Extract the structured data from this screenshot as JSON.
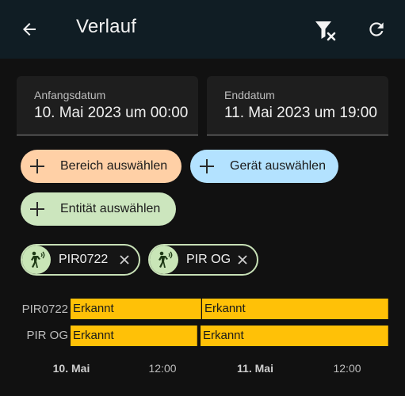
{
  "header": {
    "title": "Verlauf",
    "back_icon": "arrow-left-icon",
    "filter_icon": "filter-remove-icon",
    "refresh_icon": "refresh-icon",
    "background": "#101d24"
  },
  "dates": {
    "start_label": "Anfangsdatum",
    "start_value": "10. Mai 2023 um 00:00",
    "end_label": "Enddatum",
    "end_value": "11. Mai 2023 um 19:00"
  },
  "targets": {
    "area_label": "Bereich auswählen",
    "area_color": "#ffd0a6",
    "device_label": "Gerät auswählen",
    "device_color": "#b3e2ff",
    "entity_label": "Entität auswählen",
    "entity_color": "#cce6be"
  },
  "selected_entities": [
    {
      "name": "PIR0722",
      "icon": "motion-sensor-icon"
    },
    {
      "name": "PIR OG",
      "icon": "motion-sensor-icon"
    }
  ],
  "timeline": {
    "rows": [
      {
        "label": "PIR0722",
        "segments": [
          {
            "state": "Erkannt"
          },
          {
            "state": "Erkannt"
          }
        ]
      },
      {
        "label": "PIR OG",
        "segments": [
          {
            "state": "Erkannt"
          },
          {
            "state": "Erkannt"
          }
        ]
      }
    ],
    "state_color": "#ffc107",
    "x_ticks": [
      "10. Mai",
      "12:00",
      "11. Mai",
      "12:00"
    ]
  }
}
